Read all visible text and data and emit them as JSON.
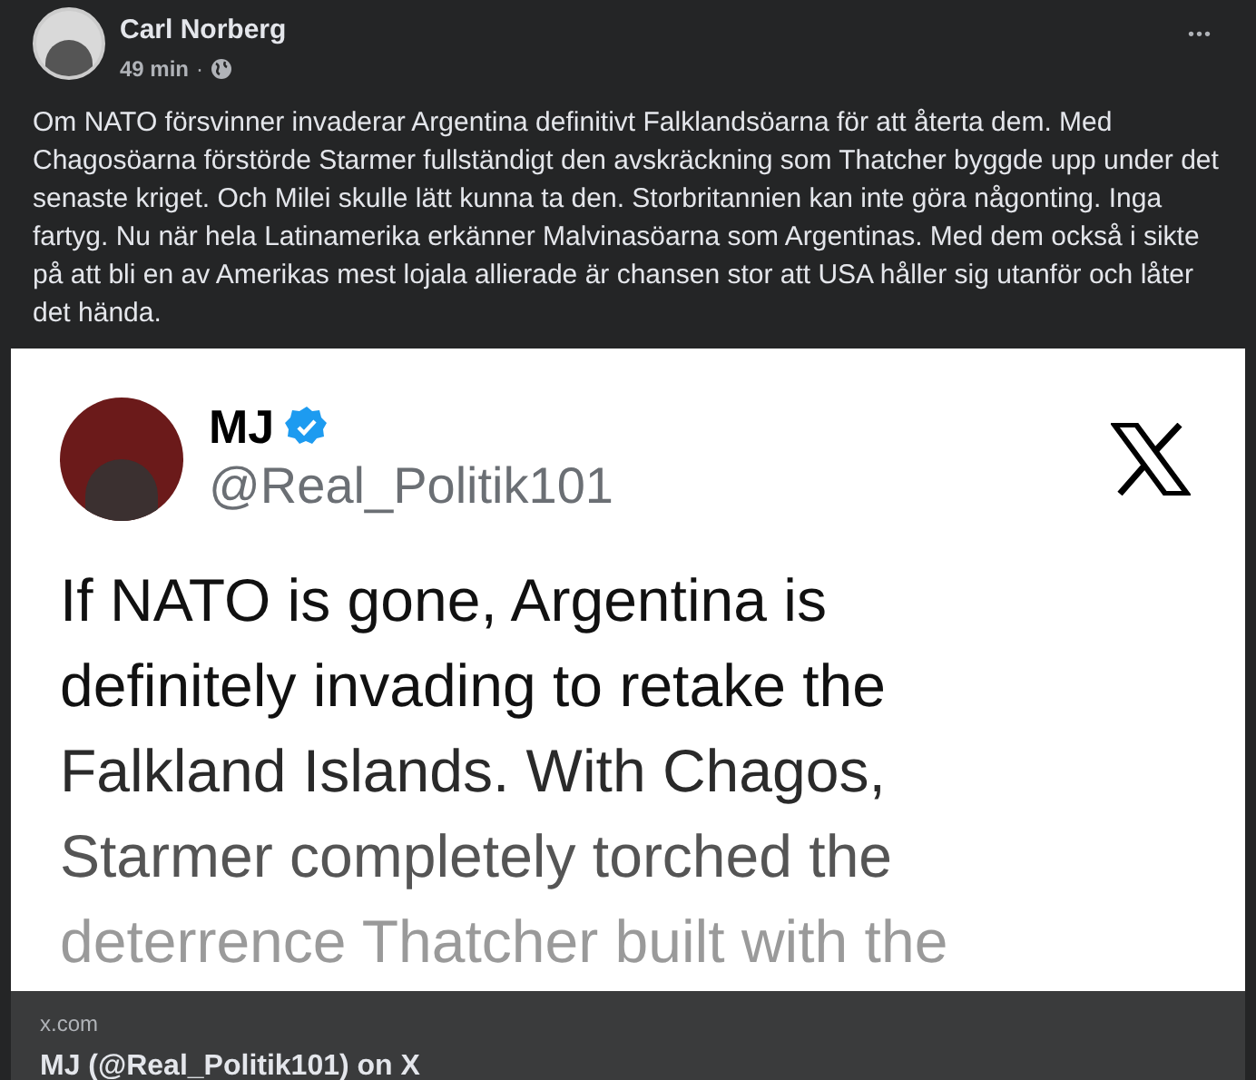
{
  "post": {
    "author": "Carl Norberg",
    "time": "49 min",
    "separator": "·",
    "more": "•••",
    "text": "Om NATO försvinner invaderar Argentina definitivt Falklandsöarna för att återta dem. Med Chagosöarna förstörde Starmer fullständigt den avskräckning som Thatcher byggde upp under det senaste kriget. Och Milei skulle lätt kunna ta den. Storbritannien kan inte göra någonting. Inga fartyg. Nu när hela Latinamerika erkänner Malvinasöarna som Argentinas. Med dem också i sikte på att bli en av Amerikas mest lojala allierade är chansen stor att USA håller sig utanför och låter det hända."
  },
  "tweet": {
    "name": "MJ",
    "verified": true,
    "handle": "@Real_Politik101",
    "lines": [
      "If NATO is gone, Argentina is",
      "definitely invading to retake the",
      "Falkland Islands. With Chagos,",
      "Starmer completely torched the",
      "deterrence Thatcher built with the"
    ]
  },
  "link_preview": {
    "domain": "x.com",
    "title": "MJ (@Real_Politik101) on X"
  }
}
